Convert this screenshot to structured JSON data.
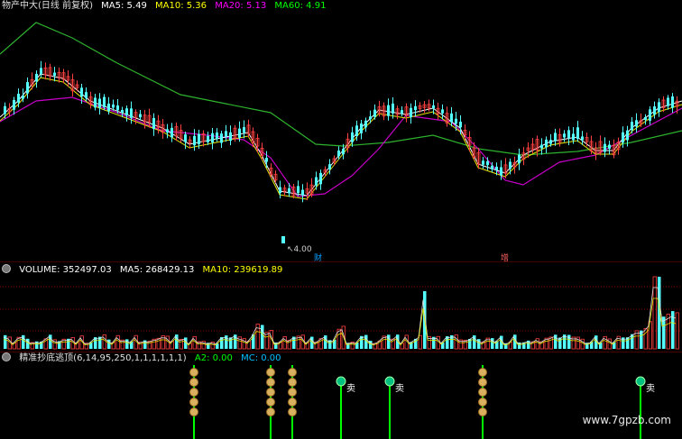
{
  "price_panel": {
    "title": "物产中大(日线 前复权)",
    "ma": [
      {
        "label": "MA5: 5.49",
        "color": "#ffffff"
      },
      {
        "label": "MA10: 5.36",
        "color": "#ffff00"
      },
      {
        "label": "MA20: 5.13",
        "color": "#ff00ff"
      },
      {
        "label": "MA60: 4.91",
        "color": "#00ff00"
      }
    ],
    "low_marker": "4.00",
    "event_tags": [
      "财",
      "增"
    ]
  },
  "volume_panel": {
    "volume_label": "VOLUME: 352497.03",
    "ma5_label": "MA5: 268429.13",
    "ma10_label": "MA10: 239619.89",
    "colors": {
      "volume": "#ffffff",
      "ma5": "#ffffff",
      "ma10": "#ffff00"
    }
  },
  "indicator_panel": {
    "name": "精准抄底逃顶(6,14,95,250,1,1,1,1,1,1)",
    "a2_label": "A2: 0.00",
    "mc_label": "MC: 0.00",
    "sell_label": "卖",
    "colors": {
      "a2": "#00ff00",
      "mc": "#00bfff"
    }
  },
  "watermark": "www.7gpzb.com",
  "colors": {
    "up": "#ff4040",
    "down": "#54ffff",
    "ma60": "#2db22d",
    "ma20": "#c800c8",
    "ma10": "#e6e600",
    "ma5": "#ffffff",
    "grid_red": "#8a0000"
  }
}
